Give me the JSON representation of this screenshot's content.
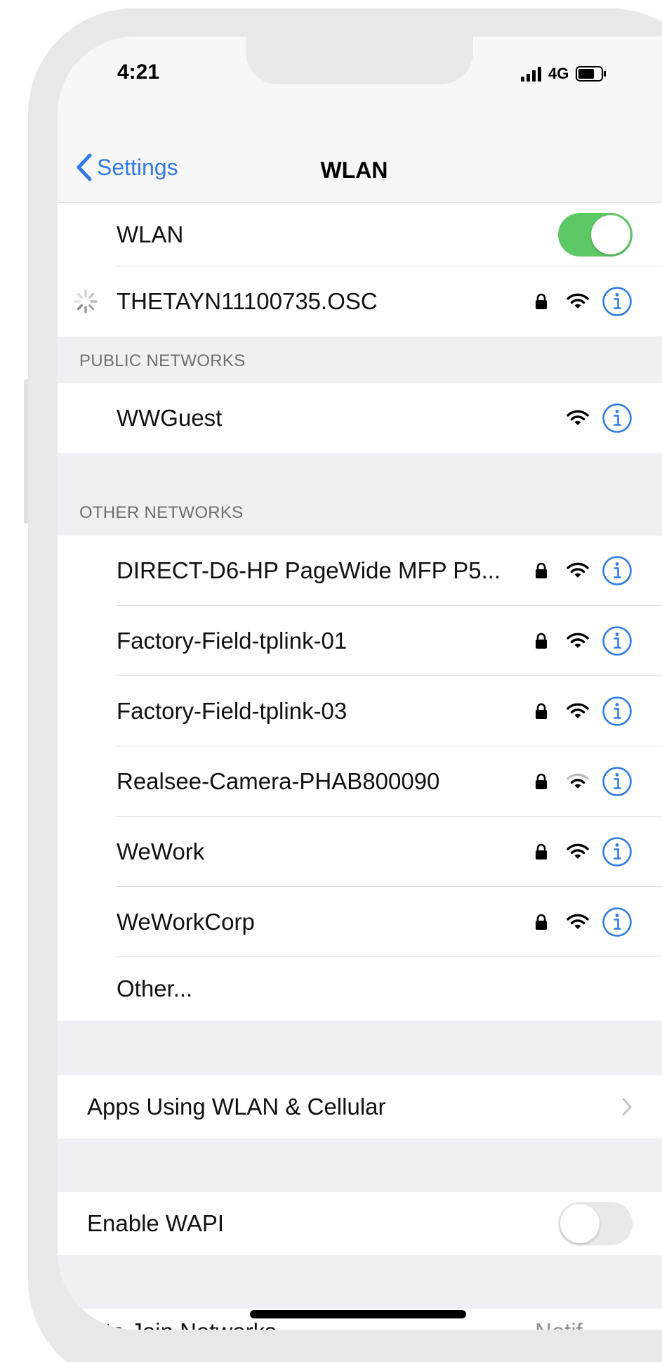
{
  "status_bar": {
    "time": "4:21",
    "network": "4G"
  },
  "nav": {
    "back_label": "Settings",
    "title": "WLAN"
  },
  "wlan": {
    "label": "WLAN",
    "enabled": true,
    "connecting_network": "THETAYN11100735.OSC"
  },
  "public_networks": {
    "header": "PUBLIC NETWORKS",
    "items": [
      {
        "name": "WWGuest",
        "locked": false,
        "signal": "strong"
      }
    ]
  },
  "other_networks": {
    "header": "OTHER NETWORKS",
    "items": [
      {
        "name": "DIRECT-D6-HP PageWide MFP P5...",
        "locked": true,
        "signal": "strong"
      },
      {
        "name": "Factory-Field-tplink-01",
        "locked": true,
        "signal": "strong"
      },
      {
        "name": "Factory-Field-tplink-03",
        "locked": true,
        "signal": "strong"
      },
      {
        "name": "Realsee-Camera-PHAB800090",
        "locked": true,
        "signal": "medium"
      },
      {
        "name": "WeWork",
        "locked": true,
        "signal": "strong"
      },
      {
        "name": "WeWorkCorp",
        "locked": true,
        "signal": "strong"
      }
    ],
    "other_label": "Other..."
  },
  "apps_using": {
    "label": "Apps Using WLAN & Cellular"
  },
  "wapi": {
    "label": "Enable WAPI",
    "enabled": false
  },
  "ask_to_join": {
    "label": "k to Join Networks",
    "value": "Notif"
  },
  "colors": {
    "accent": "#2f7ae5",
    "toggle_on": "#5fc866",
    "group_bg": "#efeff4"
  }
}
